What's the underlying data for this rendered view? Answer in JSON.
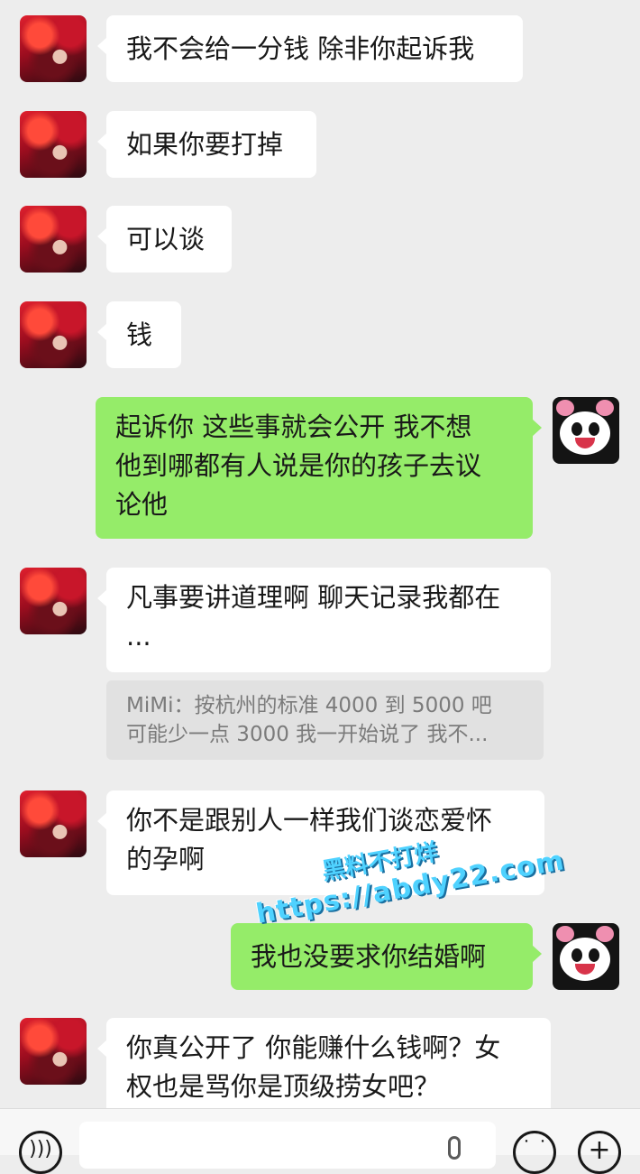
{
  "messages": [
    {
      "side": "in",
      "avatar": "red-hair-avatar",
      "text": "我不会给一分钱 除非你起诉我"
    },
    {
      "side": "in",
      "avatar": "red-hair-avatar",
      "text": "如果你要打掉"
    },
    {
      "side": "in",
      "avatar": "red-hair-avatar",
      "text": "可以谈"
    },
    {
      "side": "in",
      "avatar": "red-hair-avatar",
      "text": "钱"
    },
    {
      "side": "out",
      "avatar": "panda-avatar",
      "lines": [
        "起诉你 这些事就会公开 我不想",
        "他到哪都有人说是你的孩子去议",
        "论他"
      ]
    },
    {
      "side": "in",
      "avatar": "red-hair-avatar",
      "lines": [
        "凡事要讲道理啊 聊天记录我都在",
        "..."
      ]
    },
    {
      "side": "in",
      "avatar": "red-hair-avatar",
      "lines": [
        "你不是跟别人一样我们谈恋爱怀",
        "的孕啊"
      ]
    },
    {
      "side": "out",
      "avatar": "panda-avatar",
      "text": "我也没要求你结婚啊"
    },
    {
      "side": "in",
      "avatar": "red-hair-avatar",
      "lines": [
        "你真公开了 你能赚什么钱啊？女",
        "权也是骂你是顶级捞女吧？"
      ]
    }
  ],
  "quote": {
    "lines": [
      "MiMi：按杭州的标准 4000 到 5000 吧",
      "可能少一点 3000 我一开始说了 我不..."
    ]
  },
  "watermark": {
    "line1": "黑料不打烊",
    "line2": "https://abdy22.com"
  },
  "input_bar": {
    "voice_icon": "voice-icon",
    "mic_icon": "microphone-icon",
    "emoji_icon": "emoji-icon",
    "plus_icon": "plus-icon",
    "emoji_glyph": "˙ ˙",
    "plus_glyph": "+"
  },
  "colors": {
    "background": "#ededed",
    "incoming_bubble": "#ffffff",
    "outgoing_bubble": "#95ec69",
    "quote_bg": "#e1e1e1"
  }
}
